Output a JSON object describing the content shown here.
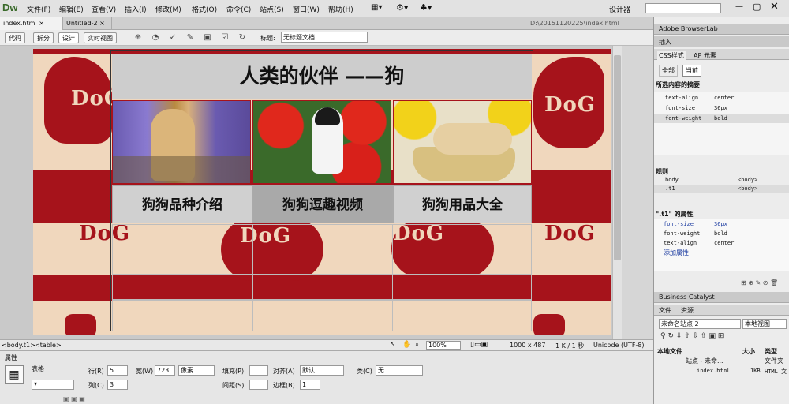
{
  "app": {
    "logo": "Dw",
    "menus": [
      "文件(F)",
      "编辑(E)",
      "查看(V)",
      "插入(I)",
      "修改(M)",
      "格式(O)",
      "命令(C)",
      "站点(S)",
      "窗口(W)",
      "帮助(H)"
    ],
    "workspace": "设计器"
  },
  "tabs": [
    "index.html",
    "Untitled-2"
  ],
  "path": "D:\\20151120225\\index.html",
  "toolbar": {
    "code": "代码",
    "split": "拆分",
    "design": "设计",
    "live": "实时视图",
    "title_label": "标题:",
    "title_value": "无标题文档"
  },
  "page": {
    "heading": "人类的伙伴 ——狗",
    "nav": [
      "狗狗品种介绍",
      "狗狗逗趣视频",
      "狗狗用品大全"
    ],
    "dog_text": "DoG"
  },
  "status": {
    "tags": [
      "<body.t1>",
      "<table>"
    ],
    "zoom": "100%",
    "size": "1000 x 487",
    "weight": "1 K / 1 秒",
    "encoding": "Unicode (UTF-8)"
  },
  "props": {
    "title": "属性",
    "type": "表格",
    "rows_label": "行(R)",
    "rows": "5",
    "cols_label": "列(C)",
    "cols": "3",
    "width_label": "宽(W)",
    "width": "723",
    "unit": "像素",
    "pad_label": "填充(P)",
    "space_label": "间距(S)",
    "align_label": "对齐(A)",
    "align": "默认",
    "border_label": "边框(B)",
    "border": "1",
    "class_label": "类(C)",
    "class": "无"
  },
  "right": {
    "browserlab": "Adobe BrowserLab",
    "insert": "插入",
    "css_tab": "CSS样式",
    "ap_tab": "AP 元素",
    "all": "全部",
    "current": "当前",
    "summary_title": "所选内容的摘要",
    "summary": [
      [
        "text-align",
        "center"
      ],
      [
        "font-size",
        "36px"
      ],
      [
        "font-weight",
        "bold"
      ]
    ],
    "rules_title": "规则",
    "rules": [
      [
        "body",
        "<body>"
      ],
      [
        ".t1",
        "<body>"
      ]
    ],
    "props_title": "\".t1\" 的属性",
    "props": [
      [
        "font-size",
        "36px"
      ],
      [
        "font-weight",
        "bold"
      ],
      [
        "text-align",
        "center"
      ]
    ],
    "add_prop": "添加属性",
    "catalyst": "Business Catalyst",
    "files_tab": "文件",
    "assets_tab": "资源",
    "site": "未命名站点 2",
    "view": "本地视图",
    "local_files": "本地文件",
    "size_col": "大小",
    "type_col": "类型",
    "site_row": "站点 - 未命...",
    "site_type": "文件夹",
    "file_name": "index.html",
    "file_size": "1KB",
    "file_type": "HTML 文"
  }
}
